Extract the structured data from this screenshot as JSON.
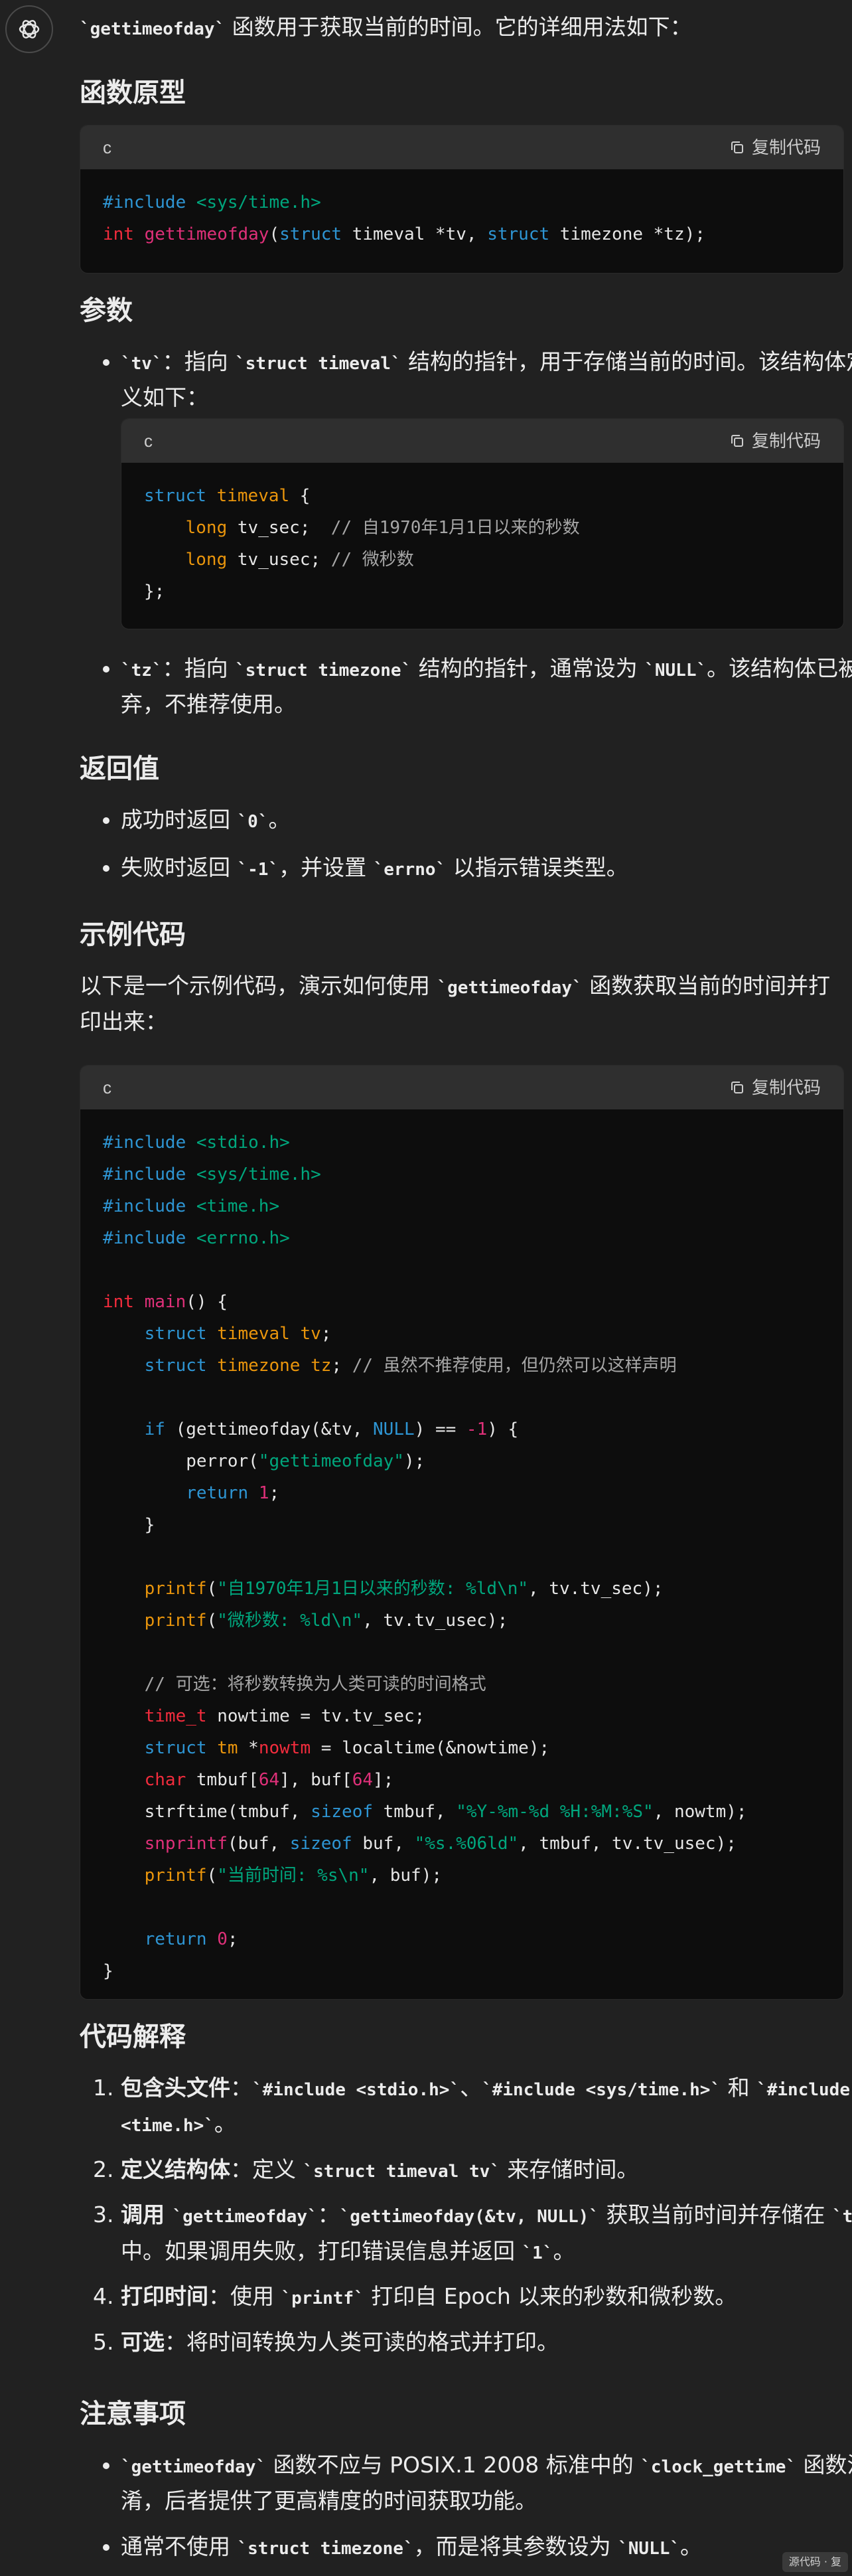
{
  "intro": {
    "code": "`gettimeofday`",
    "text": " 函数用于获取当前的时间。它的详细用法如下："
  },
  "sections": {
    "proto": "函数原型",
    "params": "参数",
    "ret": "返回值",
    "example": "示例代码",
    "explain": "代码解释",
    "notes": "注意事项"
  },
  "code_lang": "c",
  "copy_label": "复制代码",
  "params": {
    "tv_a": "`tv`",
    "tv_b": "：指向 ",
    "tv_c": "`struct timeval`",
    "tv_d": " 结构的指针，用于存储当前的时间。该结构体定义如下：",
    "tz_a": "`tz`",
    "tz_b": "：指向 ",
    "tz_c": "`struct timezone`",
    "tz_d": " 结构的指针，通常设为 ",
    "tz_e": "`NULL`",
    "tz_f": "。该结构体已被废弃，不推荐使用。"
  },
  "ret": {
    "r1a": "成功时返回 ",
    "r1b": "`0`",
    "r1c": "。",
    "r2a": "失败时返回 ",
    "r2b": "`-1`",
    "r2c": "，并设置 ",
    "r2d": "`errno`",
    "r2e": " 以指示错误类型。"
  },
  "example_intro": {
    "a": "以下是一个示例代码，演示如何使用 ",
    "b": "`gettimeofday`",
    "c": " 函数获取当前的时间并打印出来："
  },
  "explain": {
    "e1a": "包含头文件",
    "e1b": "：",
    "e1c": "`#include <stdio.h>`",
    "e1d": "、",
    "e1e": "`#include <sys/time.h>`",
    "e1f": " 和 ",
    "e1g": "`#include <time.h>`",
    "e1h": "。",
    "e2a": "定义结构体",
    "e2b": "：定义 ",
    "e2c": "`struct timeval tv`",
    "e2d": " 来存储时间。",
    "e3a": "调用 ",
    "e3b": "`gettimeofday`",
    "e3c": "：",
    "e3d": "`gettimeofday(&tv, NULL)`",
    "e3e": " 获取当前时间并存储在 ",
    "e3f": "`tv`",
    "e3g": " 中。如果调用失败，打印错误信息并返回 ",
    "e3h": "`1`",
    "e3i": "。",
    "e4a": "打印时间",
    "e4b": "：使用 ",
    "e4c": "`printf`",
    "e4d": " 打印自 Epoch 以来的秒数和微秒数。",
    "e5a": "可选",
    "e5b": "：将时间转换为人类可读的格式并打印。"
  },
  "notes": {
    "n1a": "`gettimeofday`",
    "n1b": " 函数不应与 POSIX.1 2008 标准中的 ",
    "n1c": "`clock_gettime`",
    "n1d": " 函数混淆，后者提供了更高精度的时间获取功能。",
    "n2a": "通常不使用 ",
    "n2b": "`struct timezone`",
    "n2c": "，而是将其参数设为 ",
    "n2d": "`NULL`",
    "n2e": "。"
  },
  "badge": "源代码 · 复"
}
